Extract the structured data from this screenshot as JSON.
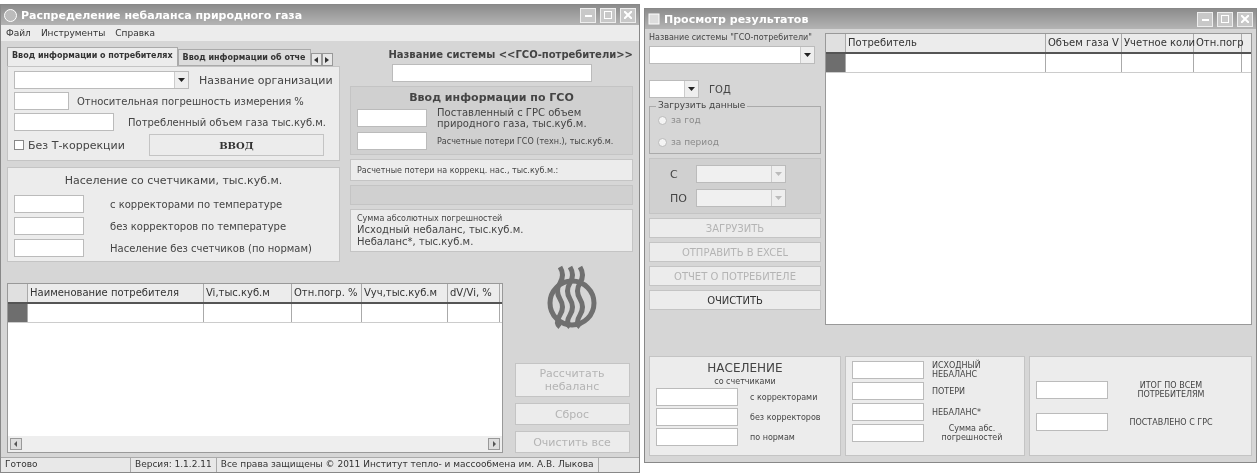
{
  "main_window": {
    "title": "Распределение небаланса природного газа",
    "menu": [
      "Файл",
      "Инструменты",
      "Справка"
    ],
    "tabs": [
      {
        "label": "Ввод информации о потребителях",
        "selected": true
      },
      {
        "label": "Ввод информации об отче",
        "selected": false
      }
    ],
    "org_label": "Название организации",
    "error_label": "Относительная погрешность измерения %",
    "volume_label": "Потребленный объем газа тыс.куб.м.",
    "t_correction": {
      "label": "Без Т-коррекции",
      "checked": false
    },
    "enter_button": {
      "label": "ВВОД",
      "disabled": false
    },
    "population": {
      "title": "Население со счетчиками, тыс.куб.м.",
      "rows": [
        "с корректорами по температуре",
        "без корректоров по температуре",
        "Население без счетчиков (по нормам)"
      ]
    },
    "system_label": "Название системы <<ГСО-потребители>>",
    "gso": {
      "title": "Ввод информации по ГСО",
      "supplied_label": "Поставленный с ГРС объем природного газа, тыс.куб.м.",
      "losses_label": "Расчетные потери ГСО (техн.), тыс.куб.м."
    },
    "correction_losses": "Расчетные потери на коррекц. нас., тыс.куб.м.:",
    "summary": [
      "Сумма абсолютных погрешностей",
      "Исходный небаланс, тыс.куб.м.",
      "Небаланс*, тыс.куб.м."
    ],
    "table": {
      "columns": [
        "Наименование потребителя",
        "Vi,тыс.куб.м",
        "Отн.погр. %",
        "Vуч,тыс.куб.м",
        "dV/Vi, %"
      ]
    },
    "buttons": [
      {
        "label": "Рассчитать небаланс",
        "disabled": true
      },
      {
        "label": "Сброс",
        "disabled": true
      },
      {
        "label": "Очистить все",
        "disabled": true
      }
    ],
    "status_bar": [
      "Готово",
      "Версия: 1.1.2.11",
      "Все права защищены © 2011  Институт тепло- и массообмена им. А.В. Лыкова"
    ]
  },
  "results_window": {
    "title": "Просмотр результатов",
    "system_label": "Название системы \"ГСО-потребители\"",
    "year_label": "ГОД",
    "load_group": {
      "title": "Загрузить данные",
      "options": [
        {
          "label": "за год",
          "selected": false,
          "disabled": true
        },
        {
          "label": "за период",
          "selected": false,
          "disabled": true
        }
      ]
    },
    "from_label": "С",
    "to_label": "ПО",
    "buttons": [
      {
        "label": "ЗАГРУЗИТЬ",
        "disabled": true
      },
      {
        "label": "ОТПРАВИТЬ В EXCEL",
        "disabled": true
      },
      {
        "label": "ОТЧЕТ О ПОТРЕБИТЕЛЕ",
        "disabled": true
      },
      {
        "label": "ОЧИСТИТЬ",
        "disabled": false
      }
    ],
    "table": {
      "columns": [
        "Потребитель",
        "Объем газа V",
        "Учетное коли",
        "Отн.погр"
      ]
    },
    "population": {
      "title": "НАСЕЛЕНИЕ",
      "subtitle": "со счетчиками",
      "rows": [
        "с корректорами",
        "без корректоров",
        "по нормам"
      ]
    },
    "balance": [
      "ИСХОДНЫЙ НЕБАЛАНС",
      "ПОТЕРИ",
      "НЕБАЛАНС*",
      "Сумма абс. погрешностей"
    ],
    "totals": [
      "ИТОГ ПО ВСЕМ ПОТРЕБИТЕЛЯМ",
      "ПОСТАВЛЕНО С ГРС"
    ]
  }
}
